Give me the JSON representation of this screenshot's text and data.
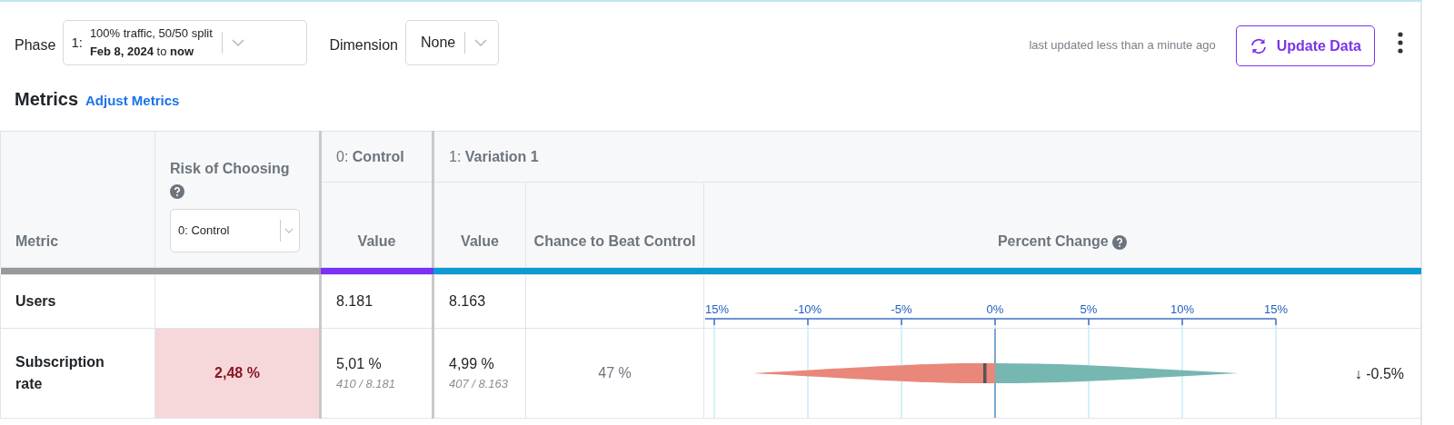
{
  "phase": {
    "label": "Phase",
    "index": "1:",
    "name": "100% traffic, 50/50 split",
    "dates": "**Feb 8, 2024** to **now**"
  },
  "dimension": {
    "label": "Dimension",
    "value": "None"
  },
  "last_updated": "last updated less than a minute ago",
  "update_button": "Update Data",
  "section_title": "Metrics",
  "adjust_link": "Adjust Metrics",
  "table": {
    "header": {
      "metric": "Metric",
      "risk": "Risk of Choosing",
      "risk_select": "0: Control",
      "control": "0: **Control**",
      "variation": "1: **Variation 1**",
      "control_value": "Value",
      "variation_value": "Value",
      "chance": "Chance to Beat Control",
      "percent_change": "Percent Change"
    },
    "axis_ticks": [
      "15%",
      "-10%",
      "-5%",
      "0%",
      "5%",
      "10%",
      "15%"
    ],
    "rows": [
      {
        "kind": "count",
        "metric": "Users",
        "control_value": "8.181",
        "variation_value": "8.163"
      },
      {
        "kind": "rate",
        "metric": "Subscription rate",
        "risk": "2,48 %",
        "risk_highlighted": true,
        "control_value": "5,01 %",
        "control_detail": "410 / 8.181",
        "variation_value": "4,99 %",
        "variation_detail": "407 / 8.163",
        "chance": "47 %",
        "change": "↓ -0.5%"
      }
    ]
  }
}
